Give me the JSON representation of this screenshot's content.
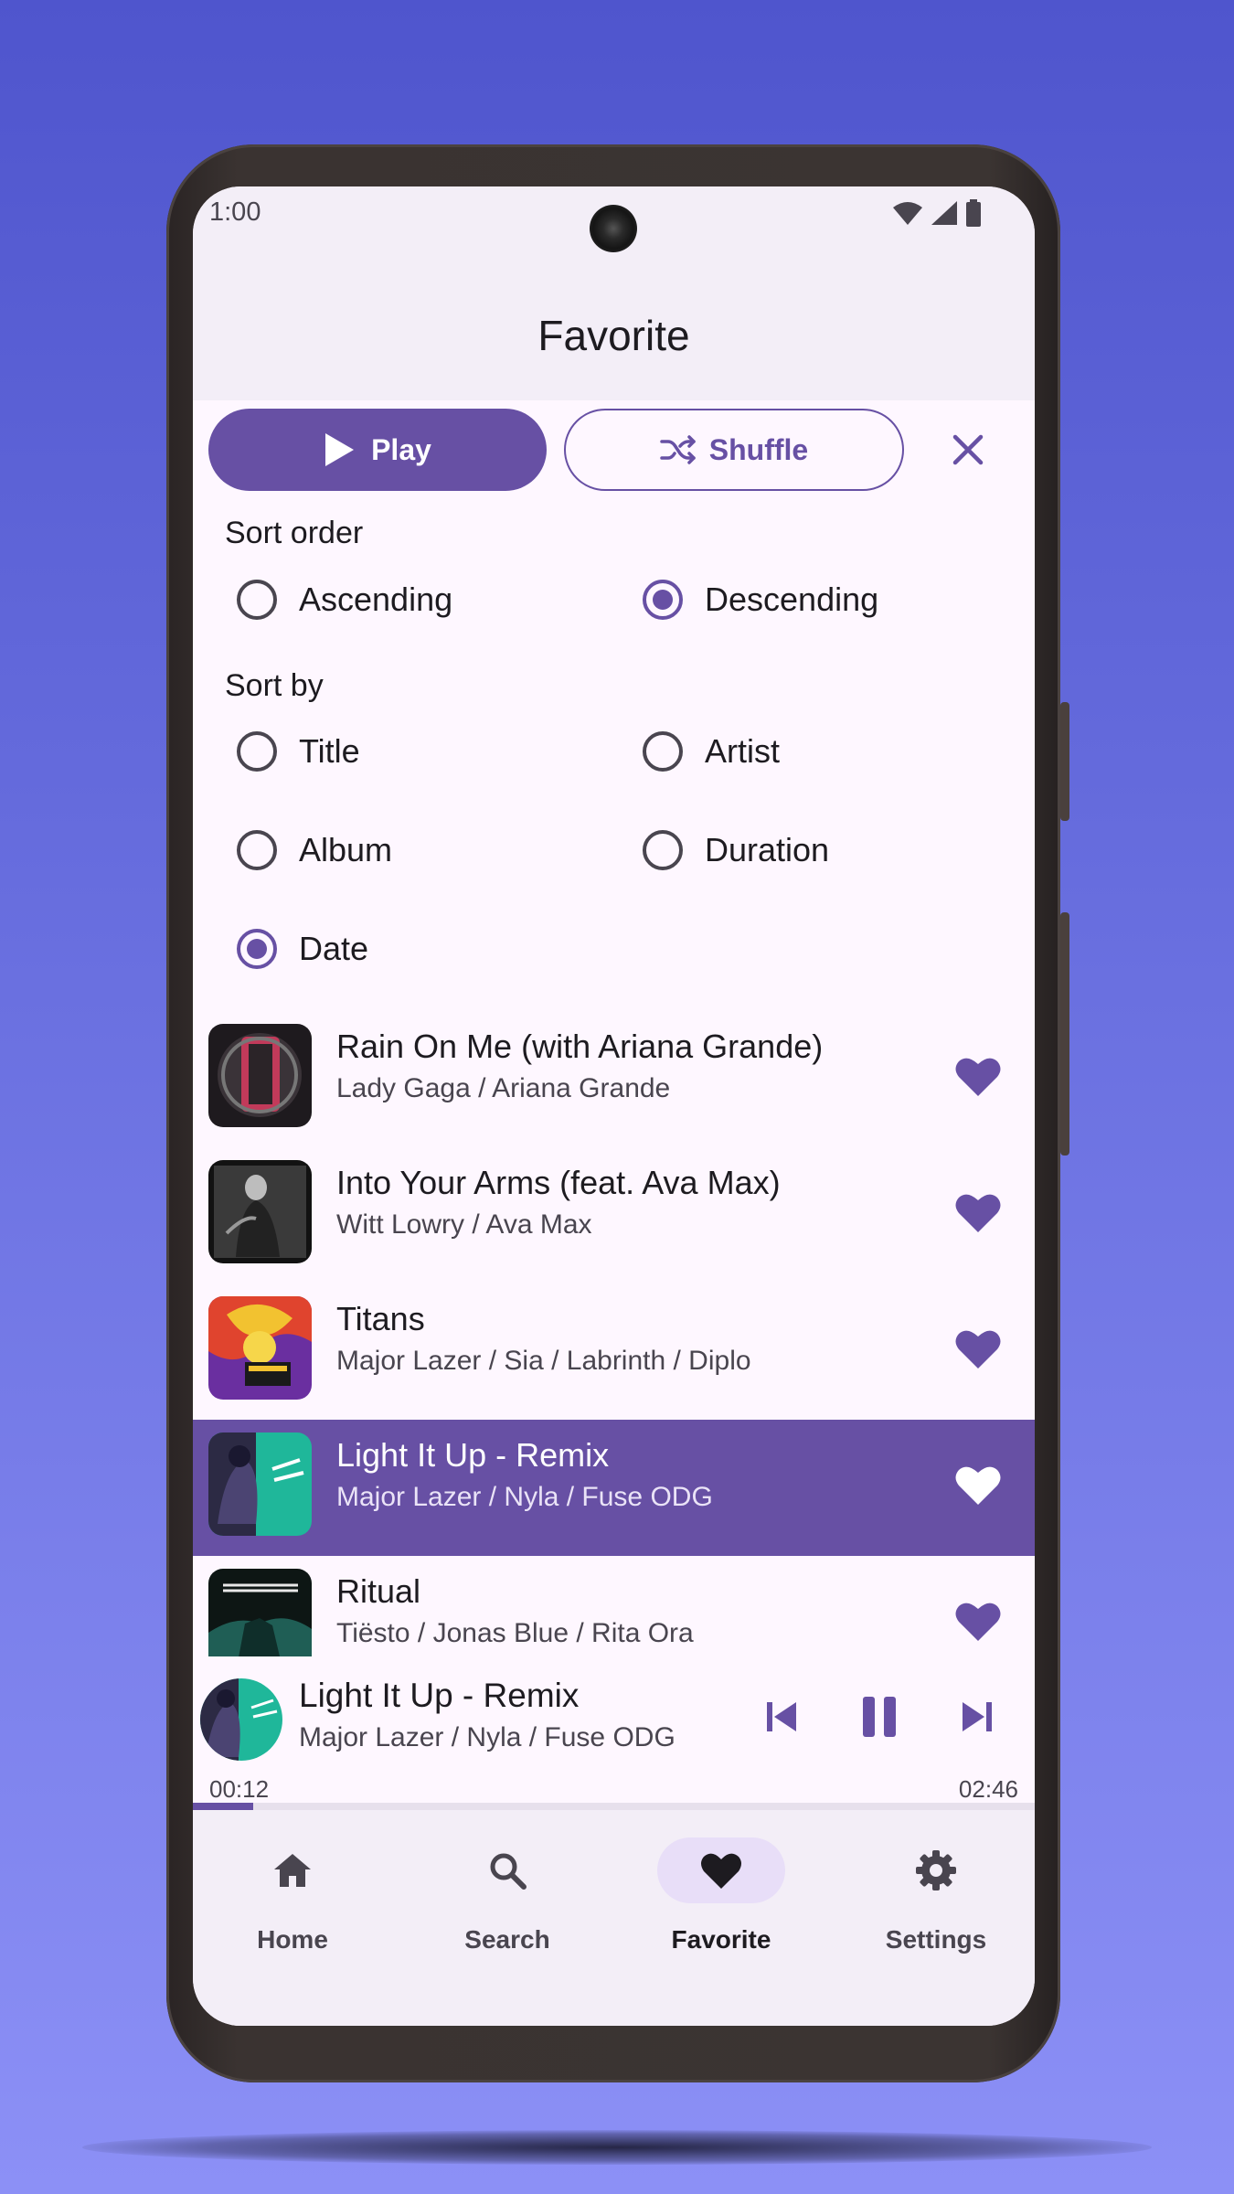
{
  "status": {
    "time": "1:00"
  },
  "header": {
    "title": "Favorite"
  },
  "actions": {
    "play_label": "Play",
    "shuffle_label": "Shuffle"
  },
  "sort_order": {
    "label": "Sort order",
    "options": [
      {
        "label": "Ascending",
        "selected": false
      },
      {
        "label": "Descending",
        "selected": true
      }
    ]
  },
  "sort_by": {
    "label": "Sort by",
    "options": [
      {
        "label": "Title",
        "selected": false
      },
      {
        "label": "Artist",
        "selected": false
      },
      {
        "label": "Album",
        "selected": false
      },
      {
        "label": "Duration",
        "selected": false
      },
      {
        "label": "Date",
        "selected": true
      }
    ]
  },
  "songs": [
    {
      "title": "Rain On Me (with Ariana Grande)",
      "artist": "Lady Gaga / Ariana Grande",
      "favorite": true,
      "active": false
    },
    {
      "title": "Into Your Arms (feat. Ava Max)",
      "artist": "Witt Lowry / Ava Max",
      "favorite": true,
      "active": false
    },
    {
      "title": "Titans",
      "artist": "Major Lazer / Sia / Labrinth / Diplo",
      "favorite": true,
      "active": false
    },
    {
      "title": "Light It Up - Remix",
      "artist": "Major Lazer / Nyla / Fuse ODG",
      "favorite": true,
      "active": true
    },
    {
      "title": "Ritual",
      "artist": "Tiësto / Jonas Blue / Rita Ora",
      "favorite": true,
      "active": false
    }
  ],
  "now_playing": {
    "title": "Light It Up - Remix",
    "artist": "Major Lazer / Nyla / Fuse ODG",
    "elapsed": "00:12",
    "duration": "02:46",
    "progress": 0.072
  },
  "nav": {
    "items": [
      {
        "label": "Home",
        "icon": "home-icon",
        "active": false
      },
      {
        "label": "Search",
        "icon": "search-icon",
        "active": false
      },
      {
        "label": "Favorite",
        "icon": "heart-icon",
        "active": true
      },
      {
        "label": "Settings",
        "icon": "gear-icon",
        "active": false
      }
    ]
  },
  "colors": {
    "primary": "#6750a4",
    "surface": "#fef7ff",
    "surface_container": "#f3eef7",
    "nav_indicator": "#e8def8"
  }
}
